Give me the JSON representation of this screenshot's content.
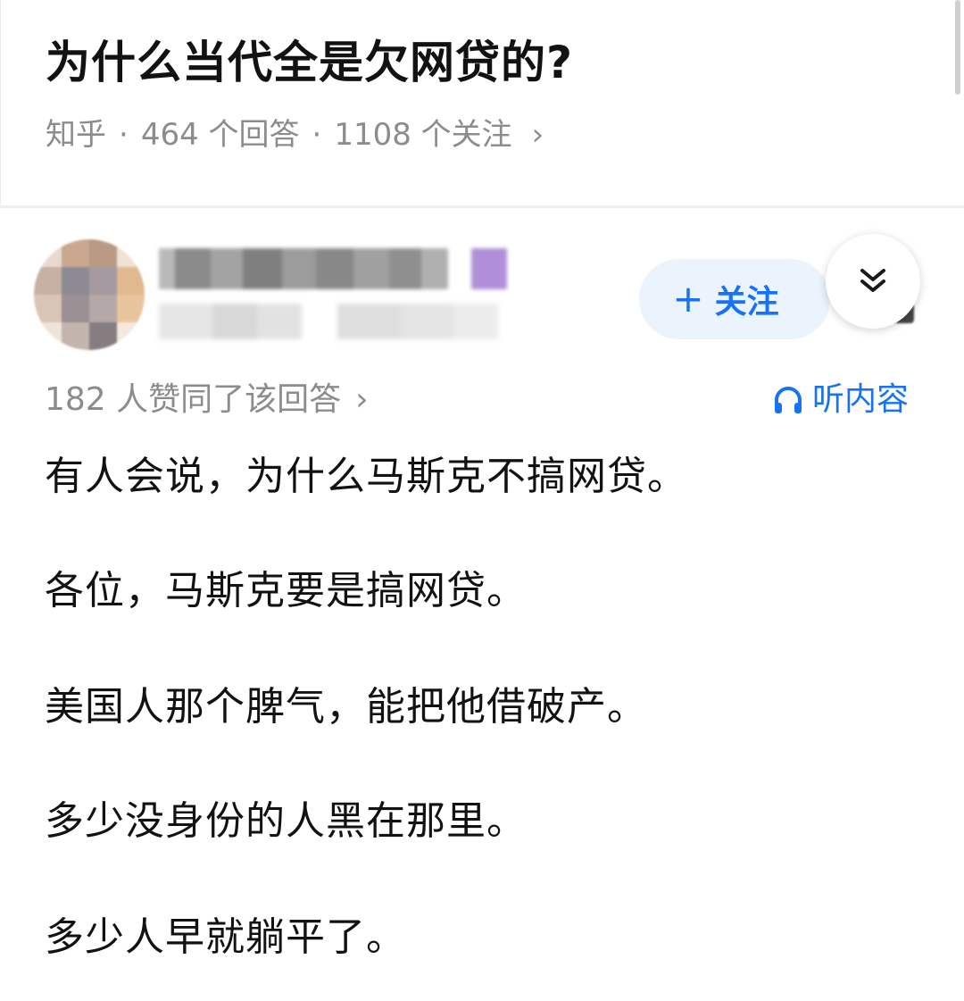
{
  "question": {
    "title": "为什么当代全是欠网贷的?",
    "source": "知乎",
    "answers": "464 个回答",
    "followers": "1108 个关注",
    "separator": "·",
    "chevron": "›"
  },
  "answer": {
    "follow_label": "关注",
    "follow_icon": "plus-icon",
    "collapse_icon": "double-chevron-down-icon",
    "likes_text": "182 人赞同了该回答",
    "likes_chevron": "›",
    "listen_label": "听内容",
    "listen_icon": "headphones-icon",
    "paragraphs": [
      "有人会说，为什么马斯克不搞网贷。",
      "各位，马斯克要是搞网贷。",
      "美国人那个脾气，能把他借破产。",
      "多少没身份的人黑在那里。",
      "多少人早就躺平了。"
    ]
  },
  "colors": {
    "accent": "#1772f6",
    "follow_bg": "#ebf3fd",
    "text": "#121212",
    "meta": "#8c8c8c"
  }
}
